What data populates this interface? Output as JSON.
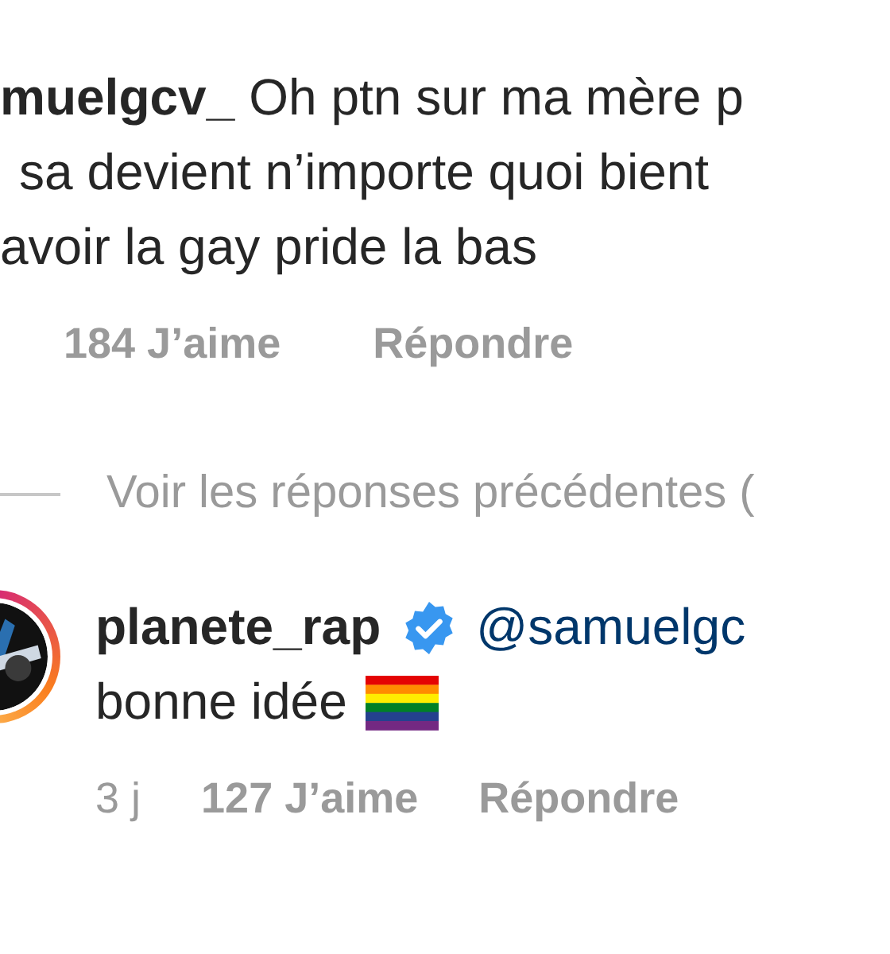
{
  "comment": {
    "username": "muelgcv_",
    "lines": [
      "Oh ptn sur ma mère p",
      "sa devient n’importe quoi bient",
      "avoir la gay pride la bas"
    ],
    "likes": "184 J’aime",
    "reply": "Répondre"
  },
  "view_previous": "Voir les réponses précédentes (",
  "reply_comment": {
    "username": "planete_rap",
    "verified": true,
    "mention": "@samuelgc",
    "text": "bonne idée",
    "time": "3 j",
    "likes": "127 J’aime",
    "reply": "Répondre"
  }
}
